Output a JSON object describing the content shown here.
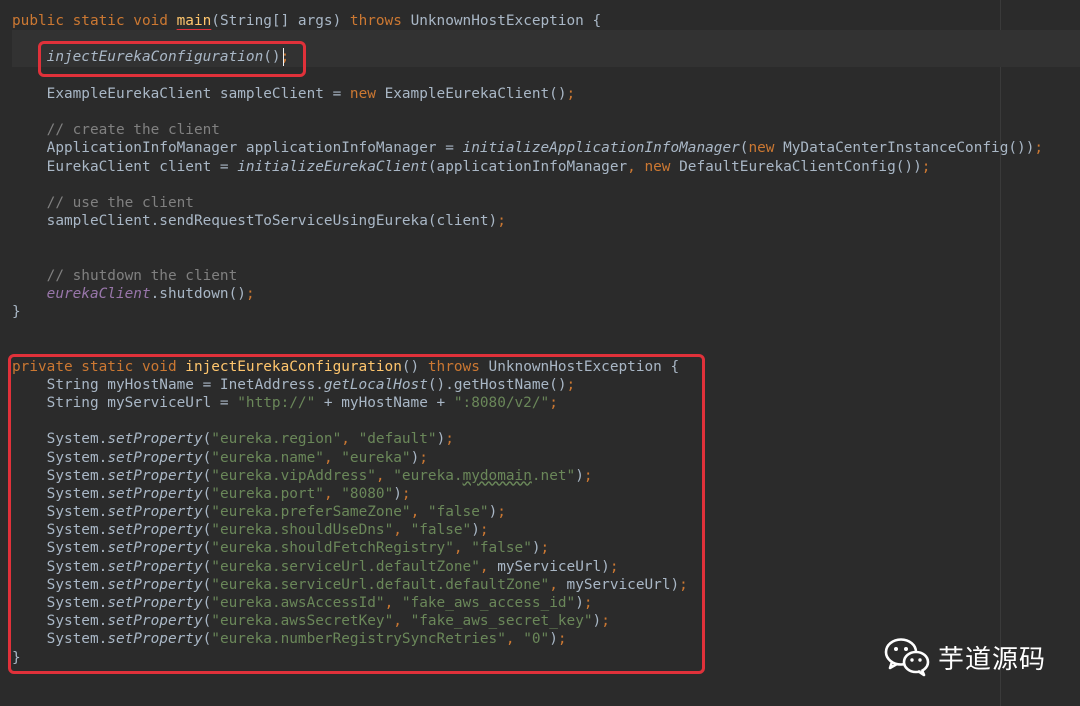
{
  "editor": {
    "theme": "darcula",
    "lines": [
      [
        [
          "kw",
          "public static void "
        ],
        [
          "method-underline",
          "main"
        ],
        [
          "plain",
          "(String[] args) "
        ],
        [
          "kw",
          "throws "
        ],
        [
          "plain",
          "UnknownHostException {"
        ]
      ],
      [],
      [
        [
          "plain",
          "    "
        ],
        [
          "italic",
          "injectEurekaConfiguration"
        ],
        [
          "plain",
          "()"
        ],
        [
          "kw",
          ";"
        ]
      ],
      [],
      [
        [
          "plain",
          "    ExampleEurekaClient sampleClient = "
        ],
        [
          "kw",
          "new "
        ],
        [
          "plain",
          "ExampleEurekaClient()"
        ],
        [
          "kw",
          ";"
        ]
      ],
      [],
      [
        [
          "comment",
          "    // create the client"
        ]
      ],
      [
        [
          "plain",
          "    ApplicationInfoManager applicationInfoManager = "
        ],
        [
          "italic",
          "initializeApplicationInfoManager"
        ],
        [
          "plain",
          "("
        ],
        [
          "kw",
          "new "
        ],
        [
          "plain",
          "MyDataCenterInstanceConfig())"
        ],
        [
          "kw",
          ";"
        ]
      ],
      [
        [
          "plain",
          "    EurekaClient client = "
        ],
        [
          "italic",
          "initializeEurekaClient"
        ],
        [
          "plain",
          "(applicationInfoManager"
        ],
        [
          "kw",
          ", new "
        ],
        [
          "plain",
          "DefaultEurekaClientConfig())"
        ],
        [
          "kw",
          ";"
        ]
      ],
      [],
      [
        [
          "comment",
          "    // use the client"
        ]
      ],
      [
        [
          "plain",
          "    sampleClient.sendRequestToServiceUsingEureka(client)"
        ],
        [
          "kw",
          ";"
        ]
      ],
      [],
      [],
      [
        [
          "comment",
          "    // shutdown the client"
        ]
      ],
      [
        [
          "plain",
          "    "
        ],
        [
          "field",
          "eurekaClient"
        ],
        [
          "plain",
          ".shutdown()"
        ],
        [
          "kw",
          ";"
        ]
      ],
      [
        [
          "plain",
          "}"
        ]
      ],
      [],
      [],
      [
        [
          "kw",
          "private static void "
        ],
        [
          "method",
          "injectEurekaConfiguration"
        ],
        [
          "plain",
          "() "
        ],
        [
          "kw",
          "throws "
        ],
        [
          "plain",
          "UnknownHostException {"
        ]
      ],
      [
        [
          "plain",
          "    String myHostName = InetAddress."
        ],
        [
          "italic",
          "getLocalHost"
        ],
        [
          "plain",
          "().getHostName()"
        ],
        [
          "kw",
          ";"
        ]
      ],
      [
        [
          "plain",
          "    String myServiceUrl = "
        ],
        [
          "string",
          "\"http://\""
        ],
        [
          "plain",
          " + myHostName + "
        ],
        [
          "string",
          "\":8080/v2/\""
        ],
        [
          "kw",
          ";"
        ]
      ],
      [],
      [
        [
          "plain",
          "    System."
        ],
        [
          "italic",
          "setProperty"
        ],
        [
          "plain",
          "("
        ],
        [
          "string",
          "\"eureka.region\""
        ],
        [
          "kw",
          ", "
        ],
        [
          "string",
          "\"default\""
        ],
        [
          "plain",
          ")"
        ],
        [
          "kw",
          ";"
        ]
      ],
      [
        [
          "plain",
          "    System."
        ],
        [
          "italic",
          "setProperty"
        ],
        [
          "plain",
          "("
        ],
        [
          "string",
          "\"eureka.name\""
        ],
        [
          "kw",
          ", "
        ],
        [
          "string",
          "\"eureka\""
        ],
        [
          "plain",
          ")"
        ],
        [
          "kw",
          ";"
        ]
      ],
      [
        [
          "plain",
          "    System."
        ],
        [
          "italic",
          "setProperty"
        ],
        [
          "plain",
          "("
        ],
        [
          "string",
          "\"eureka.vipAddress\""
        ],
        [
          "kw",
          ", "
        ],
        [
          "string",
          "\"eureka."
        ],
        [
          "string-underline",
          "mydomain"
        ],
        [
          "string",
          ".net\""
        ],
        [
          "plain",
          ")"
        ],
        [
          "kw",
          ";"
        ]
      ],
      [
        [
          "plain",
          "    System."
        ],
        [
          "italic",
          "setProperty"
        ],
        [
          "plain",
          "("
        ],
        [
          "string",
          "\"eureka.port\""
        ],
        [
          "kw",
          ", "
        ],
        [
          "string",
          "\"8080\""
        ],
        [
          "plain",
          ")"
        ],
        [
          "kw",
          ";"
        ]
      ],
      [
        [
          "plain",
          "    System."
        ],
        [
          "italic",
          "setProperty"
        ],
        [
          "plain",
          "("
        ],
        [
          "string",
          "\"eureka.preferSameZone\""
        ],
        [
          "kw",
          ", "
        ],
        [
          "string",
          "\"false\""
        ],
        [
          "plain",
          ")"
        ],
        [
          "kw",
          ";"
        ]
      ],
      [
        [
          "plain",
          "    System."
        ],
        [
          "italic",
          "setProperty"
        ],
        [
          "plain",
          "("
        ],
        [
          "string",
          "\"eureka.shouldUseDns\""
        ],
        [
          "kw",
          ", "
        ],
        [
          "string",
          "\"false\""
        ],
        [
          "plain",
          ")"
        ],
        [
          "kw",
          ";"
        ]
      ],
      [
        [
          "plain",
          "    System."
        ],
        [
          "italic",
          "setProperty"
        ],
        [
          "plain",
          "("
        ],
        [
          "string",
          "\"eureka.shouldFetchRegistry\""
        ],
        [
          "kw",
          ", "
        ],
        [
          "string",
          "\"false\""
        ],
        [
          "plain",
          ")"
        ],
        [
          "kw",
          ";"
        ]
      ],
      [
        [
          "plain",
          "    System."
        ],
        [
          "italic",
          "setProperty"
        ],
        [
          "plain",
          "("
        ],
        [
          "string",
          "\"eureka.serviceUrl.defaultZone\""
        ],
        [
          "kw",
          ", "
        ],
        [
          "plain",
          "myServiceUrl)"
        ],
        [
          "kw",
          ";"
        ]
      ],
      [
        [
          "plain",
          "    System."
        ],
        [
          "italic",
          "setProperty"
        ],
        [
          "plain",
          "("
        ],
        [
          "string",
          "\"eureka.serviceUrl.default.defaultZone\""
        ],
        [
          "kw",
          ", "
        ],
        [
          "plain",
          "myServiceUrl)"
        ],
        [
          "kw",
          ";"
        ]
      ],
      [
        [
          "plain",
          "    System."
        ],
        [
          "italic",
          "setProperty"
        ],
        [
          "plain",
          "("
        ],
        [
          "string",
          "\"eureka.awsAccessId\""
        ],
        [
          "kw",
          ", "
        ],
        [
          "string",
          "\"fake_aws_access_id\""
        ],
        [
          "plain",
          ")"
        ],
        [
          "kw",
          ";"
        ]
      ],
      [
        [
          "plain",
          "    System."
        ],
        [
          "italic",
          "setProperty"
        ],
        [
          "plain",
          "("
        ],
        [
          "string",
          "\"eureka.awsSecretKey\""
        ],
        [
          "kw",
          ", "
        ],
        [
          "string",
          "\"fake_aws_secret_key\""
        ],
        [
          "plain",
          ")"
        ],
        [
          "kw",
          ";"
        ]
      ],
      [
        [
          "plain",
          "    System."
        ],
        [
          "italic",
          "setProperty"
        ],
        [
          "plain",
          "("
        ],
        [
          "string",
          "\"eureka.numberRegistrySyncRetries\""
        ],
        [
          "kw",
          ", "
        ],
        [
          "string",
          "\"0\""
        ],
        [
          "plain",
          ")"
        ],
        [
          "kw",
          ";"
        ]
      ],
      [
        [
          "plain",
          "}"
        ]
      ]
    ],
    "highlighted_lines": [
      1,
      2
    ]
  },
  "watermark": {
    "icon": "wechat-icon",
    "text": "芋道源码"
  },
  "colors": {
    "background": "#2b2b2b",
    "keyword": "#cc7832",
    "method": "#ffc66d",
    "comment": "#808080",
    "string": "#6a8759",
    "plain": "#a9b7c6",
    "field": "#9876aa",
    "annotation_box": "#e0313a"
  }
}
